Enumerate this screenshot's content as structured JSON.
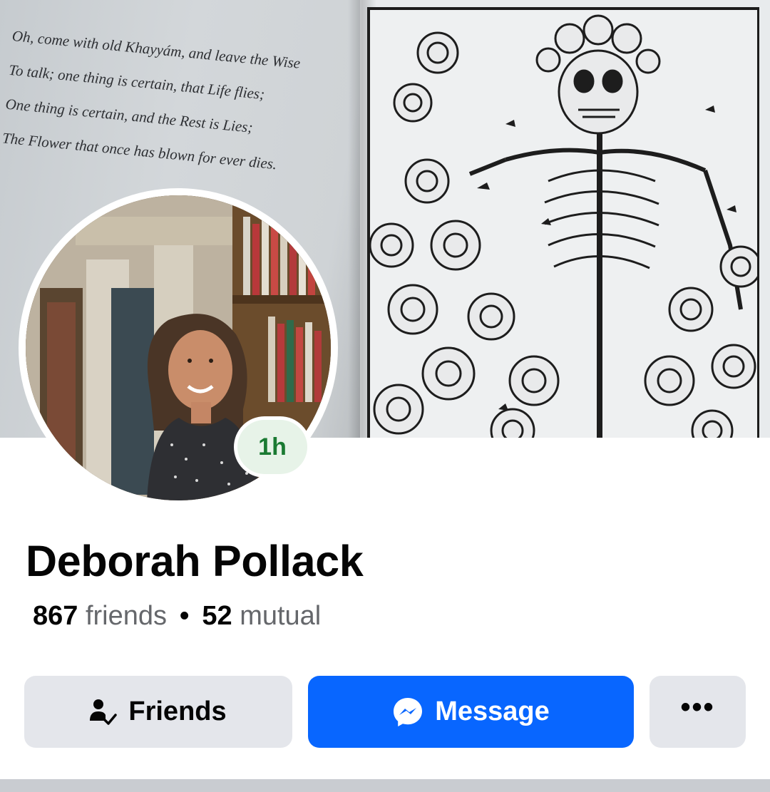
{
  "cover": {
    "poem_lines": [
      "Oh, come with old Khayyám, and leave the Wise",
      "To talk; one thing is certain, that Life flies;",
      "One thing is certain, and the Rest is Lies;",
      "The Flower that once has blown for ever dies."
    ]
  },
  "profile": {
    "story_age": "1h",
    "name": "Deborah Pollack",
    "friends_count": "867",
    "friends_label": "friends",
    "separator": "•",
    "mutual_count": "52",
    "mutual_label": "mutual"
  },
  "actions": {
    "friends_label": "Friends",
    "friends_icon": "person-check-icon",
    "message_label": "Message",
    "message_icon": "messenger-icon",
    "more_label": "•••",
    "more_icon": "more-dots-icon"
  },
  "colors": {
    "primary_blue": "#0866ff",
    "secondary_gray": "#e4e6eb",
    "story_green": "#1a7a32",
    "text_primary": "#050505",
    "text_secondary": "#65676b"
  }
}
